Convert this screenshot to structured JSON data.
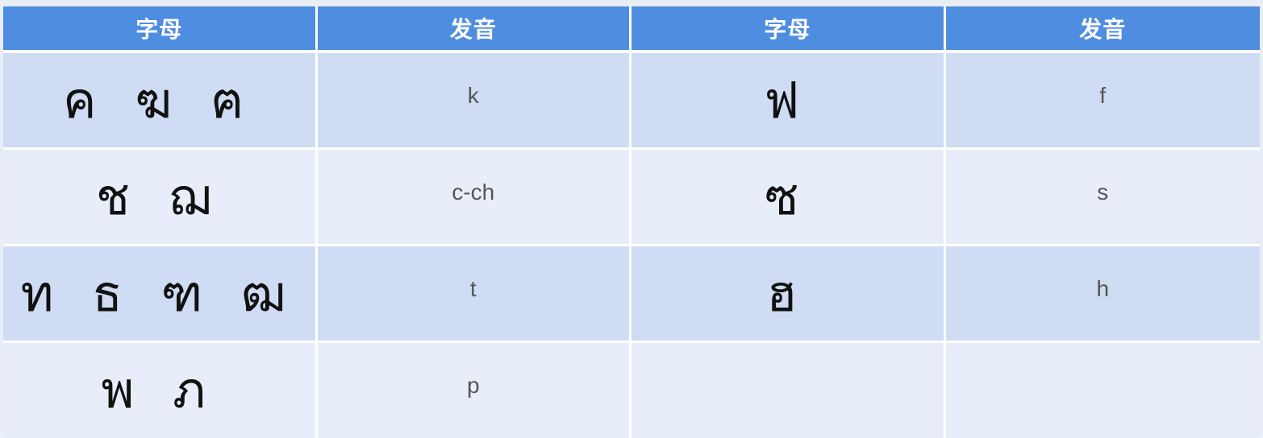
{
  "headers": [
    "字母",
    "发音",
    "字母",
    "发音"
  ],
  "rows": [
    {
      "letters_left": "ค ฆ ฅ",
      "sound_left": "k",
      "letters_right": "ฟ",
      "sound_right": "f"
    },
    {
      "letters_left": "ช ฌ",
      "sound_left": "c-ch",
      "letters_right": "ซ",
      "sound_right": "s"
    },
    {
      "letters_left": "ท ธ ฑ ฒ",
      "sound_left": "t",
      "letters_right": "ฮ",
      "sound_right": "h"
    },
    {
      "letters_left": "พ ภ",
      "sound_left": "p",
      "letters_right": "",
      "sound_right": ""
    }
  ],
  "colors": {
    "header_bg": "#4f8de0",
    "row_odd_bg": "#cfdcf3",
    "row_even_bg": "#e8eef9"
  }
}
